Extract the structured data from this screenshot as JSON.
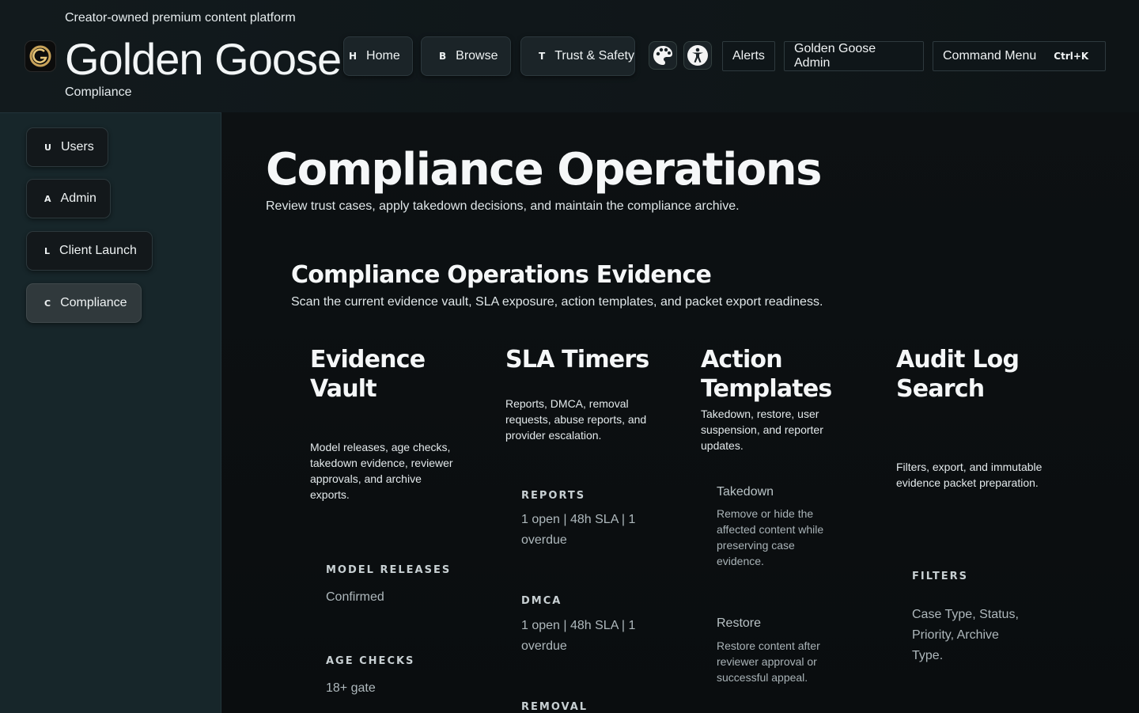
{
  "header": {
    "tagline": "Creator-owned premium content platform",
    "brand": "Golden Goose",
    "section": "Compliance"
  },
  "nav": {
    "home": {
      "key": "H",
      "label": "Home"
    },
    "browse": {
      "key": "B",
      "label": "Browse"
    },
    "trust": {
      "key": "T",
      "label": "Trust & Safety"
    },
    "alerts": "Alerts",
    "admin": "Golden Goose Admin",
    "command": "Command Menu",
    "command_kbd": "Ctrl+K"
  },
  "sidebar": {
    "items": [
      {
        "key": "U",
        "label": "Users"
      },
      {
        "key": "A",
        "label": "Admin"
      },
      {
        "key": "L",
        "label": "Client Launch"
      },
      {
        "key": "C",
        "label": "Compliance"
      }
    ]
  },
  "page": {
    "title": "Compliance Operations",
    "subtitle": "Review trust cases, apply takedown decisions, and maintain the compliance archive."
  },
  "evidence": {
    "title": "Compliance Operations Evidence",
    "subtitle": "Scan the current evidence vault, SLA exposure, action templates, and packet export readiness.",
    "vault": {
      "title": "Evidence Vault",
      "desc": "Model releases, age checks, takedown evidence, reviewer approvals, and archive exports.",
      "fields": [
        {
          "label": "MODEL RELEASES",
          "value": "Confirmed"
        },
        {
          "label": "AGE CHECKS",
          "value": "18+ gate"
        }
      ]
    },
    "sla": {
      "title": "SLA Timers",
      "desc": "Reports, DMCA, removal requests, abuse reports, and provider escalation.",
      "fields": [
        {
          "label": "REPORTS",
          "value": "1 open | 48h SLA | 1 overdue"
        },
        {
          "label": "DMCA",
          "value": "1 open | 48h SLA | 1 overdue"
        },
        {
          "label": "REMOVAL",
          "value": ""
        }
      ]
    },
    "templates": {
      "title": "Action Templates",
      "desc": "Takedown, restore, user suspension, and reporter updates.",
      "items": [
        {
          "name": "Takedown",
          "desc": "Remove or hide the affected content while preserving case evidence."
        },
        {
          "name": "Restore",
          "desc": "Restore content after reviewer approval or successful appeal."
        }
      ]
    },
    "audit": {
      "title": "Audit Log Search",
      "desc": "Filters, export, and immutable evidence packet preparation.",
      "fields": [
        {
          "label": "FILTERS",
          "value": "Case Type, Status, Priority, Archive Type."
        }
      ]
    }
  },
  "colors": {
    "background": "#0a0d0f",
    "sidebar": "#17262a",
    "gold": "#c9a35a"
  }
}
